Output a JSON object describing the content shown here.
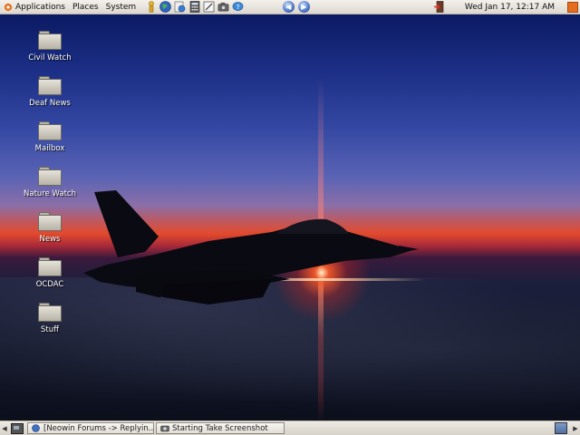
{
  "top_panel": {
    "menus": [
      "Applications",
      "Places",
      "System"
    ],
    "launchers": [
      "accessibility-icon",
      "web-browser-icon",
      "email-client-icon",
      "calculator-icon",
      "text-editor-icon",
      "screenshot-camera-icon",
      "help-icon"
    ],
    "clock": "Wed Jan 17, 12:17 AM"
  },
  "desktop": {
    "icons": [
      {
        "label": "Civil Watch"
      },
      {
        "label": "Deaf News"
      },
      {
        "label": "Mailbox"
      },
      {
        "label": "Nature Watch"
      },
      {
        "label": "News"
      },
      {
        "label": "OCDAC"
      },
      {
        "label": "Stuff"
      }
    ]
  },
  "bottom_panel": {
    "tasks": [
      {
        "label": "[Neowin Forums -> Replyin...",
        "icon": "browser-icon"
      },
      {
        "label": "Starting Take Screenshot",
        "icon": "camera-icon"
      }
    ]
  },
  "colors": {
    "panel": "#dcd7cf",
    "sky_top": "#0b1a63",
    "horizon": "#e24a2c",
    "accent": "#e56d1f"
  }
}
